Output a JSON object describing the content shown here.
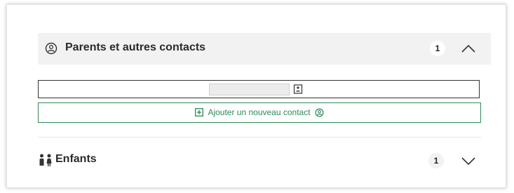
{
  "parents_section": {
    "title": "Parents et autres contacts",
    "count": "1",
    "expanded": true
  },
  "contact_row": {
    "input_value": ""
  },
  "add_contact": {
    "label": "Ajouter un nouveau contact"
  },
  "children_section": {
    "title": "Enfants",
    "count": "1",
    "expanded": false
  },
  "colors": {
    "accent_green": "#2e8a57",
    "header_bg": "#f2f2f2"
  },
  "icons": {
    "parents": "person-circle-icon",
    "collapse": "chevron-up-icon",
    "contact_card": "contact-card-icon",
    "add": "plus-square-icon",
    "add_person": "person-circle-icon",
    "children": "children-icon",
    "expand": "chevron-down-icon"
  }
}
